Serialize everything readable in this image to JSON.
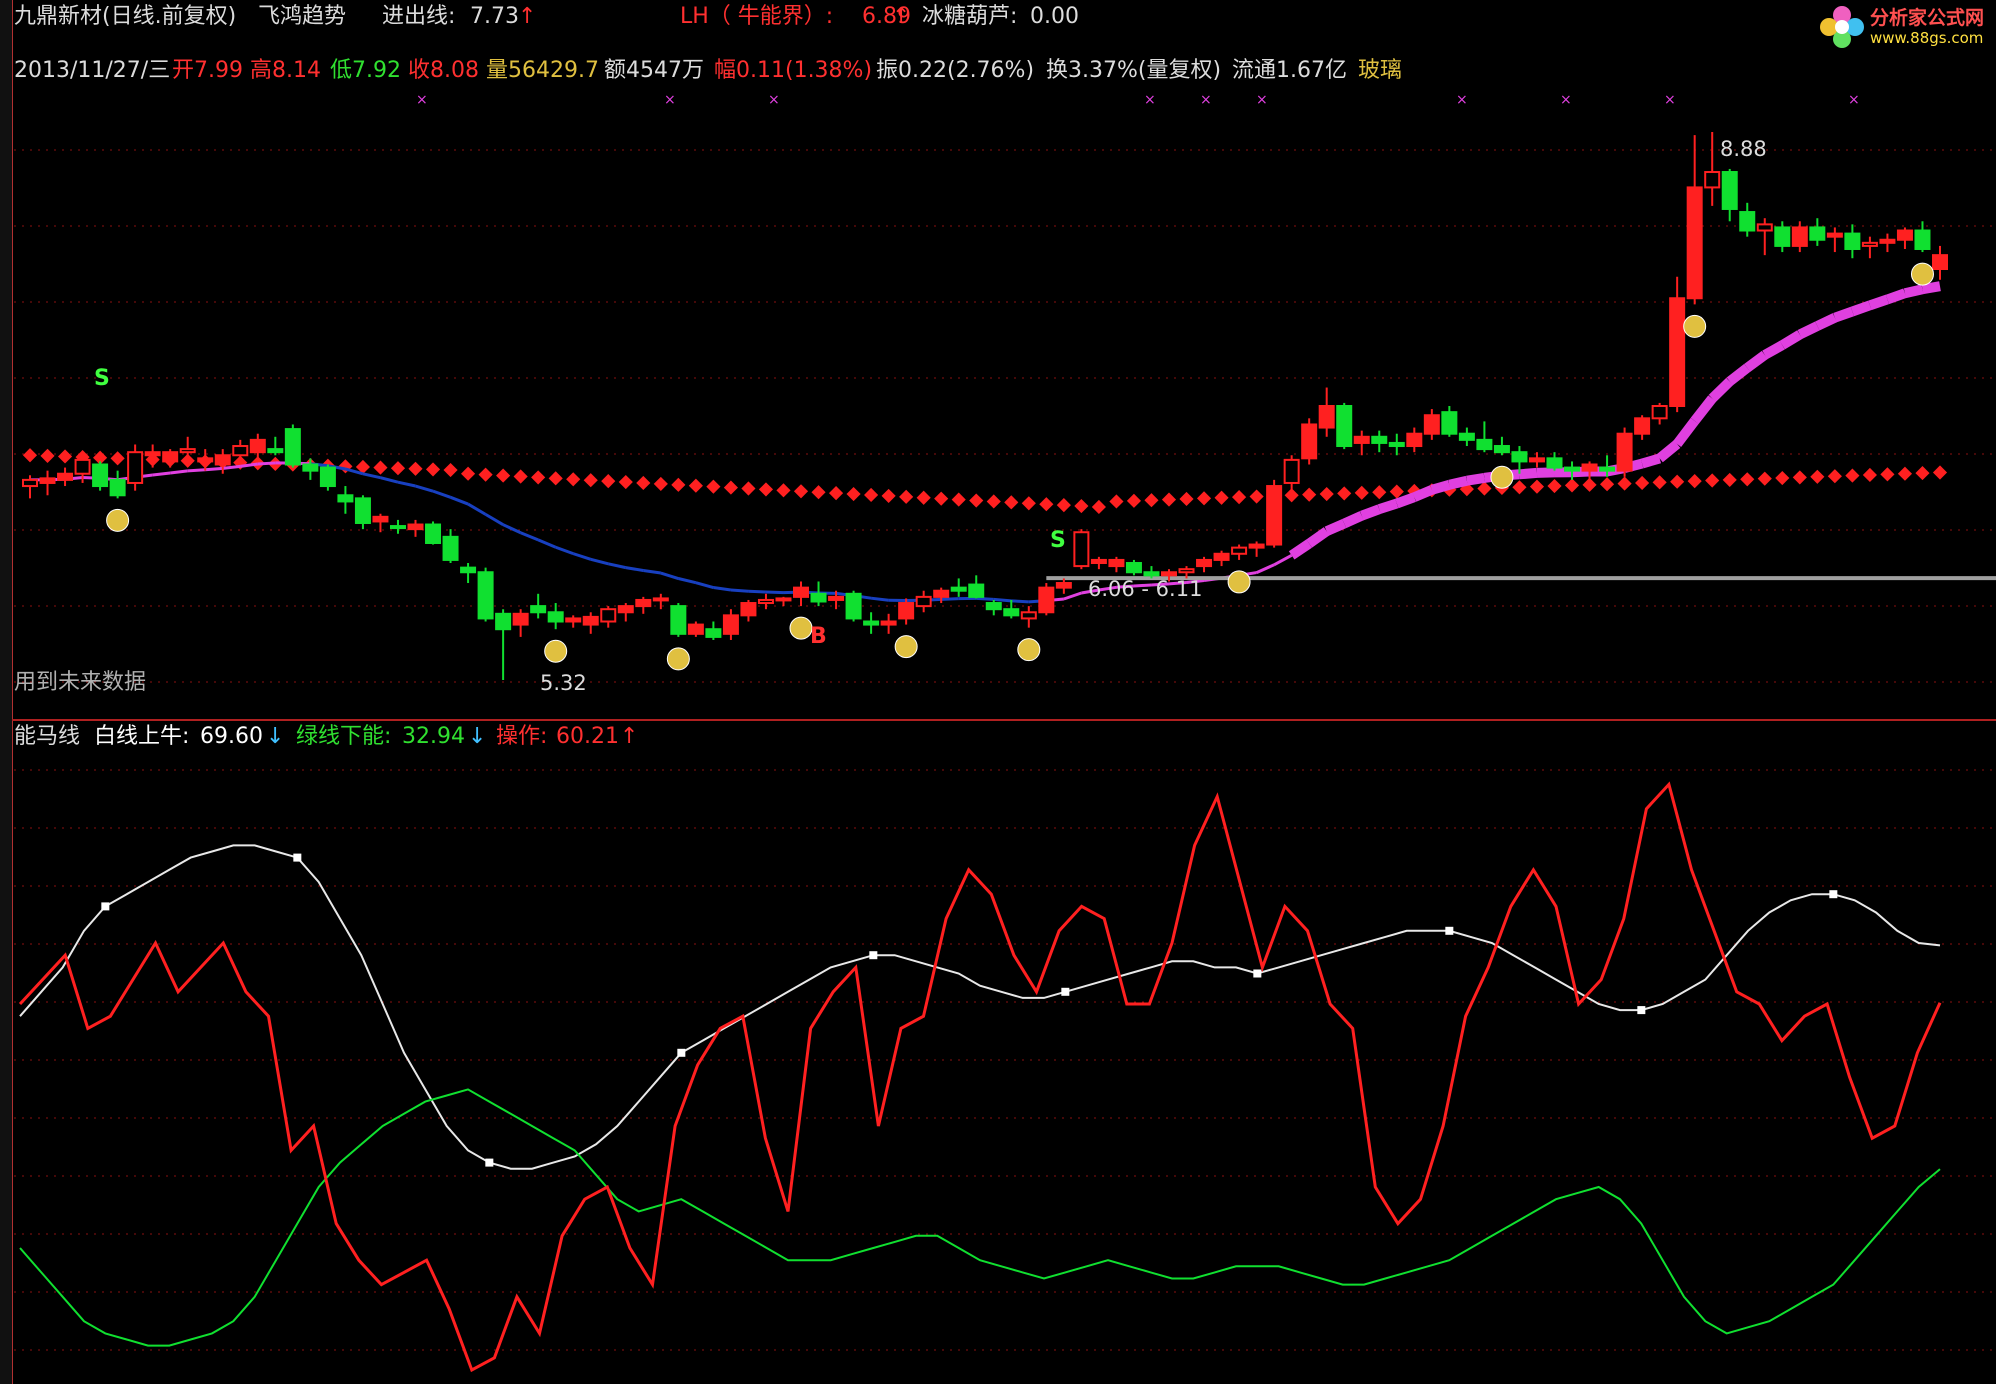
{
  "header": {
    "stock": "九鼎新材(日线.前复权)",
    "indicator": "飞鸿趋势",
    "entry_label": "进出线:",
    "entry_value": "7.73",
    "entry_arrow": "↑",
    "lh_label": "LH（ 牛能界）:",
    "lh_value": "6.89",
    "lh_arrow": "↑",
    "bingtang_label": "冰糖葫芦:",
    "bingtang_value": "0.00"
  },
  "quote": {
    "date": "2013/11/27/三",
    "open_label": "开",
    "open": "7.99",
    "high_label": "高",
    "high": "8.14",
    "low_label": "低",
    "low": "7.92",
    "close_label": "收",
    "close": "8.08",
    "vol_label": "量",
    "vol": "56429.7",
    "amount": "额4547万",
    "range_label": "幅",
    "range": "0.11(1.38%)",
    "amp": "振0.22(2.76%)",
    "turnover": "换3.37%(量复权)",
    "float": "流通1.67亿",
    "sector": "玻璃"
  },
  "logo": {
    "text": "分析家公式网",
    "url": "www.88gs.com"
  },
  "annotations": {
    "high_price": "8.88",
    "low_price": "5.32",
    "range_text": "6.06 - 6.11",
    "future_note": "用到未来数据",
    "sell_marker": "S",
    "buy_marker": "B"
  },
  "lower_panel": {
    "title": "能马线",
    "white_label": "白线上牛:",
    "white_value": "69.60",
    "white_arrow": "↓",
    "green_label": "绿线下能:",
    "green_value": "32.94",
    "green_arrow": "↓",
    "red_label": "操作:",
    "red_value": "60.21",
    "red_arrow": "↑"
  },
  "colors": {
    "up": "#ff2020",
    "down": "#10e030",
    "white": "#e8e8e8",
    "blue": "#1840c0",
    "magenta": "#e040e0",
    "gold": "#e0c040",
    "grid": "#8a1010"
  },
  "chart_data": [
    {
      "type": "candlestick",
      "title": "飞鸿趋势",
      "price_ticks": {
        "high_label": "8.88",
        "low_label": "5.32"
      },
      "candles": [
        [
          6.58,
          6.65,
          6.5,
          6.62
        ],
        [
          6.6,
          6.68,
          6.52,
          6.63
        ],
        [
          6.62,
          6.7,
          6.58,
          6.66
        ],
        [
          6.66,
          6.78,
          6.6,
          6.75
        ],
        [
          6.72,
          6.74,
          6.55,
          6.58
        ],
        [
          6.62,
          6.68,
          6.5,
          6.52
        ],
        [
          6.6,
          6.85,
          6.55,
          6.8
        ],
        [
          6.78,
          6.85,
          6.7,
          6.8
        ],
        [
          6.74,
          6.82,
          6.7,
          6.8
        ],
        [
          6.8,
          6.9,
          6.72,
          6.82
        ],
        [
          6.74,
          6.82,
          6.68,
          6.76
        ],
        [
          6.72,
          6.82,
          6.66,
          6.78
        ],
        [
          6.78,
          6.88,
          6.74,
          6.84
        ],
        [
          6.8,
          6.92,
          6.75,
          6.88
        ],
        [
          6.82,
          6.9,
          6.78,
          6.8
        ],
        [
          6.95,
          6.98,
          6.7,
          6.72
        ],
        [
          6.72,
          6.76,
          6.62,
          6.68
        ],
        [
          6.7,
          6.72,
          6.55,
          6.58
        ],
        [
          6.52,
          6.58,
          6.4,
          6.48
        ],
        [
          6.5,
          6.52,
          6.3,
          6.34
        ],
        [
          6.35,
          6.4,
          6.28,
          6.38
        ],
        [
          6.32,
          6.36,
          6.27,
          6.31
        ],
        [
          6.3,
          6.36,
          6.25,
          6.33
        ],
        [
          6.33,
          6.35,
          6.2,
          6.21
        ],
        [
          6.25,
          6.3,
          6.08,
          6.1
        ],
        [
          6.05,
          6.08,
          5.95,
          6.02
        ],
        [
          6.02,
          6.05,
          5.7,
          5.72
        ],
        [
          5.75,
          5.78,
          5.32,
          5.65
        ],
        [
          5.68,
          5.78,
          5.6,
          5.75
        ],
        [
          5.8,
          5.88,
          5.72,
          5.76
        ],
        [
          5.76,
          5.82,
          5.65,
          5.7
        ],
        [
          5.7,
          5.74,
          5.66,
          5.72
        ],
        [
          5.68,
          5.76,
          5.62,
          5.73
        ],
        [
          5.7,
          5.8,
          5.66,
          5.78
        ],
        [
          5.76,
          5.82,
          5.7,
          5.8
        ],
        [
          5.8,
          5.86,
          5.75,
          5.84
        ],
        [
          5.84,
          5.88,
          5.78,
          5.85
        ],
        [
          5.8,
          5.82,
          5.6,
          5.62
        ],
        [
          5.62,
          5.7,
          5.6,
          5.68
        ],
        [
          5.65,
          5.7,
          5.58,
          5.6
        ],
        [
          5.62,
          5.78,
          5.58,
          5.74
        ],
        [
          5.74,
          5.84,
          5.7,
          5.82
        ],
        [
          5.82,
          5.88,
          5.78,
          5.84
        ],
        [
          5.84,
          5.86,
          5.8,
          5.85
        ],
        [
          5.86,
          5.96,
          5.8,
          5.92
        ],
        [
          5.88,
          5.96,
          5.8,
          5.83
        ],
        [
          5.84,
          5.9,
          5.78,
          5.86
        ],
        [
          5.88,
          5.9,
          5.7,
          5.72
        ],
        [
          5.7,
          5.76,
          5.62,
          5.68
        ],
        [
          5.68,
          5.75,
          5.62,
          5.7
        ],
        [
          5.72,
          5.85,
          5.68,
          5.82
        ],
        [
          5.8,
          5.9,
          5.76,
          5.86
        ],
        [
          5.86,
          5.92,
          5.82,
          5.9
        ],
        [
          5.92,
          5.98,
          5.86,
          5.9
        ],
        [
          5.94,
          6.0,
          5.85,
          5.86
        ],
        [
          5.82,
          5.84,
          5.74,
          5.78
        ],
        [
          5.78,
          5.84,
          5.72,
          5.74
        ],
        [
          5.72,
          5.8,
          5.66,
          5.76
        ],
        [
          5.76,
          5.95,
          5.74,
          5.92
        ],
        [
          5.92,
          5.98,
          5.88,
          5.95
        ],
        [
          6.06,
          6.3,
          6.04,
          6.28
        ],
        [
          6.08,
          6.12,
          6.04,
          6.1
        ],
        [
          6.06,
          6.12,
          6.02,
          6.1
        ],
        [
          6.08,
          6.1,
          6.0,
          6.02
        ],
        [
          6.02,
          6.06,
          5.98,
          6.0
        ],
        [
          6.0,
          6.04,
          5.96,
          6.02
        ],
        [
          6.02,
          6.06,
          5.98,
          6.04
        ],
        [
          6.06,
          6.12,
          6.02,
          6.1
        ],
        [
          6.1,
          6.16,
          6.06,
          6.14
        ],
        [
          6.14,
          6.2,
          6.1,
          6.18
        ],
        [
          6.18,
          6.22,
          6.12,
          6.2
        ],
        [
          6.2,
          6.62,
          6.18,
          6.58
        ],
        [
          6.6,
          6.78,
          6.56,
          6.75
        ],
        [
          6.76,
          7.02,
          6.72,
          6.98
        ],
        [
          6.96,
          7.22,
          6.9,
          7.1
        ],
        [
          7.1,
          7.12,
          6.82,
          6.84
        ],
        [
          6.86,
          6.94,
          6.78,
          6.9
        ],
        [
          6.9,
          6.94,
          6.8,
          6.86
        ],
        [
          6.86,
          6.92,
          6.78,
          6.84
        ],
        [
          6.84,
          6.96,
          6.8,
          6.92
        ],
        [
          6.92,
          7.08,
          6.88,
          7.04
        ],
        [
          7.06,
          7.1,
          6.9,
          6.92
        ],
        [
          6.92,
          6.96,
          6.84,
          6.88
        ],
        [
          6.88,
          7.0,
          6.8,
          6.82
        ],
        [
          6.84,
          6.9,
          6.78,
          6.8
        ],
        [
          6.8,
          6.84,
          6.66,
          6.74
        ],
        [
          6.74,
          6.8,
          6.7,
          6.76
        ],
        [
          6.76,
          6.8,
          6.68,
          6.7
        ],
        [
          6.7,
          6.74,
          6.62,
          6.68
        ],
        [
          6.68,
          6.74,
          6.6,
          6.72
        ],
        [
          6.7,
          6.78,
          6.64,
          6.68
        ],
        [
          6.68,
          6.96,
          6.64,
          6.92
        ],
        [
          6.92,
          7.04,
          6.88,
          7.02
        ],
        [
          7.02,
          7.12,
          6.98,
          7.1
        ],
        [
          7.1,
          7.94,
          7.06,
          7.8
        ],
        [
          7.8,
          8.86,
          7.76,
          8.52
        ],
        [
          8.52,
          8.88,
          8.4,
          8.62
        ],
        [
          8.62,
          8.64,
          8.3,
          8.38
        ],
        [
          8.36,
          8.42,
          8.2,
          8.24
        ],
        [
          8.24,
          8.32,
          8.08,
          8.28
        ],
        [
          8.26,
          8.3,
          8.1,
          8.14
        ],
        [
          8.14,
          8.3,
          8.1,
          8.26
        ],
        [
          8.26,
          8.32,
          8.14,
          8.18
        ],
        [
          8.2,
          8.26,
          8.1,
          8.22
        ],
        [
          8.22,
          8.28,
          8.06,
          8.12
        ],
        [
          8.14,
          8.2,
          8.06,
          8.16
        ],
        [
          8.16,
          8.22,
          8.1,
          8.18
        ],
        [
          8.18,
          8.26,
          8.12,
          8.24
        ],
        [
          8.24,
          8.3,
          8.1,
          8.12
        ],
        [
          7.99,
          8.14,
          7.92,
          8.08
        ]
      ]
    },
    {
      "type": "line",
      "title": "能马线",
      "ylim": [
        0,
        100
      ],
      "series": [
        {
          "name": "白线上牛",
          "values": [
            58,
            62,
            66,
            72,
            76,
            78,
            80,
            82,
            84,
            85,
            86,
            86,
            85,
            84,
            80,
            74,
            68,
            60,
            52,
            46,
            40,
            36,
            34,
            33,
            33,
            34,
            35,
            37,
            40,
            44,
            48,
            52,
            54,
            56,
            58,
            60,
            62,
            64,
            66,
            67,
            68,
            68,
            67,
            66,
            65,
            63,
            62,
            61,
            61,
            62,
            63,
            64,
            65,
            66,
            67,
            67,
            66,
            66,
            65,
            66,
            67,
            68,
            69,
            70,
            71,
            72,
            72,
            72,
            71,
            70,
            68,
            66,
            64,
            62,
            60,
            59,
            59,
            60,
            62,
            64,
            68,
            72,
            75,
            77,
            78,
            78,
            77,
            75,
            72,
            70,
            69.6
          ]
        },
        {
          "name": "绿线下能",
          "values": [
            20,
            16,
            12,
            8,
            6,
            5,
            4,
            4,
            5,
            6,
            8,
            12,
            18,
            24,
            30,
            34,
            37,
            40,
            42,
            44,
            45,
            46,
            44,
            42,
            40,
            38,
            36,
            32,
            28,
            26,
            27,
            28,
            26,
            24,
            22,
            20,
            18,
            18,
            18,
            19,
            20,
            21,
            22,
            22,
            20,
            18,
            17,
            16,
            15,
            16,
            17,
            18,
            17,
            16,
            15,
            15,
            16,
            17,
            17,
            17,
            16,
            15,
            14,
            14,
            15,
            16,
            17,
            18,
            20,
            22,
            24,
            26,
            28,
            29,
            30,
            28,
            24,
            18,
            12,
            8,
            6,
            7,
            8,
            10,
            12,
            14,
            18,
            22,
            26,
            30,
            32.94
          ]
        },
        {
          "name": "操作",
          "values": [
            60,
            64,
            68,
            56,
            58,
            64,
            70,
            62,
            66,
            70,
            62,
            58,
            36,
            40,
            24,
            18,
            14,
            16,
            18,
            10,
            0,
            2,
            12,
            6,
            22,
            28,
            30,
            20,
            14,
            40,
            50,
            56,
            58,
            38,
            26,
            56,
            62,
            66,
            40,
            56,
            58,
            74,
            82,
            78,
            68,
            62,
            72,
            76,
            74,
            60,
            60,
            70,
            86,
            94,
            80,
            66,
            76,
            72,
            60,
            56,
            30,
            24,
            28,
            40,
            58,
            66,
            76,
            82,
            76,
            60,
            64,
            74,
            92,
            96,
            82,
            72,
            62,
            60,
            54,
            58,
            60,
            48,
            38,
            40,
            52,
            60.21
          ]
        }
      ]
    }
  ]
}
